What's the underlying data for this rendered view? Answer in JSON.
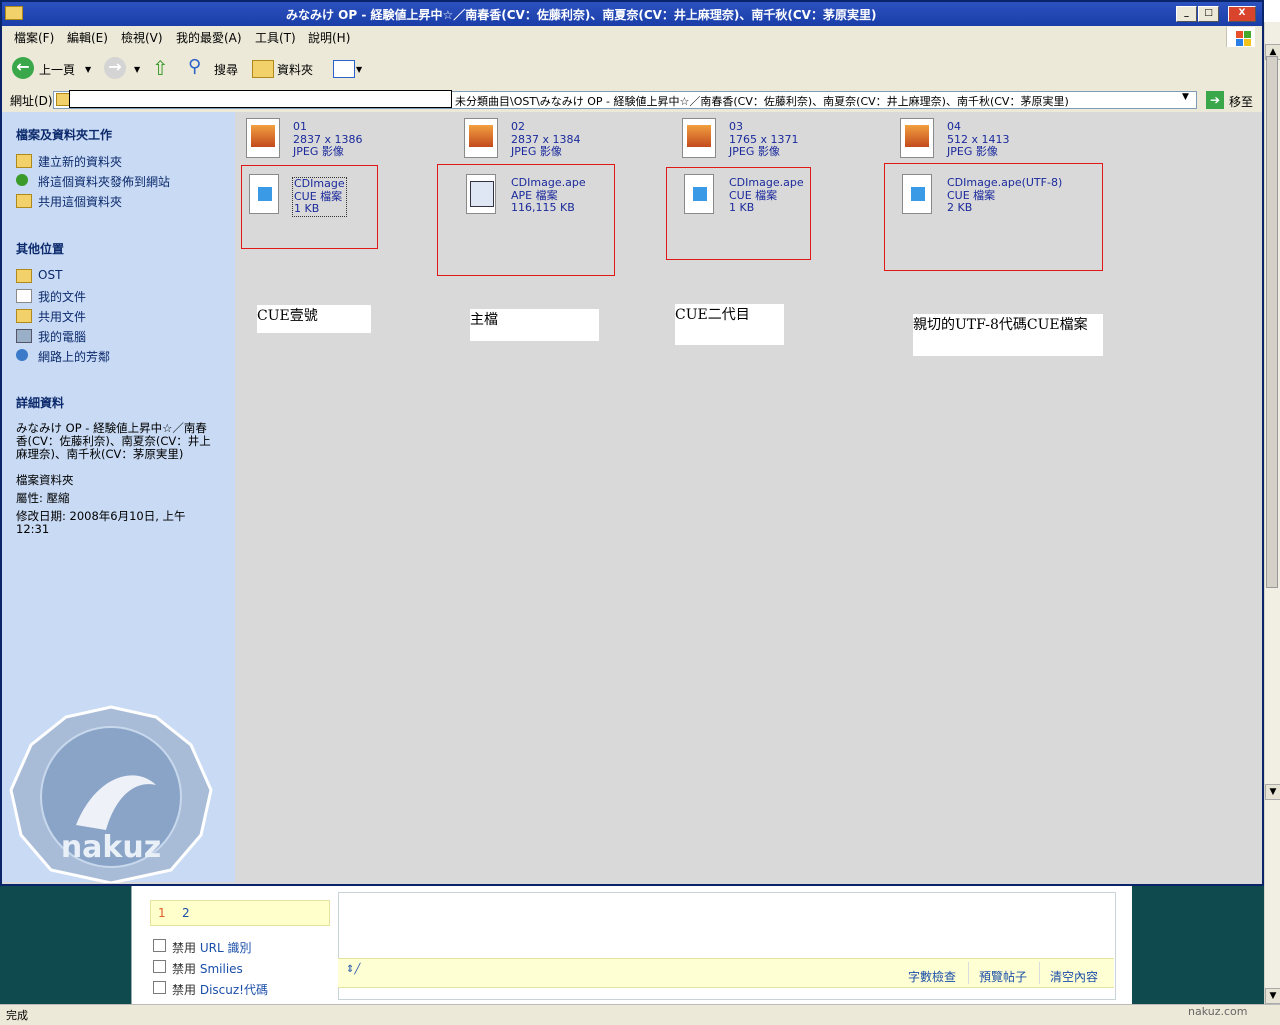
{
  "window": {
    "title": "みなみけ OP - 経験値上昇中☆／南春香(CV：佐藤利奈)、南夏奈(CV：井上麻理奈)、南千秋(CV：茅原実里)",
    "minimize_glyph": "_",
    "maximize_glyph": "□",
    "close_glyph": "X"
  },
  "menu": {
    "items": [
      "檔案(F)",
      "編輯(E)",
      "檢視(V)",
      "我的最愛(A)",
      "工具(T)",
      "說明(H)"
    ]
  },
  "toolbar": {
    "back_label": "上一頁",
    "search_label": "搜尋",
    "folders_label": "資料夾"
  },
  "address": {
    "label": "網址(D)",
    "path": "未分類曲目\\OST\\みなみけ OP - 経験値上昇中☆／南春香(CV：佐藤利奈)、南夏奈(CV：井上麻理奈)、南千秋(CV：茅原実里)",
    "go_label": "移至"
  },
  "taskpane": {
    "file_tasks": {
      "heading": "檔案及資料夾工作",
      "items": [
        "建立新的資料夾",
        "將這個資料夾發佈到網站",
        "共用這個資料夾"
      ]
    },
    "other_places": {
      "heading": "其他位置",
      "items": [
        "OST",
        "我的文件",
        "共用文件",
        "我的電腦",
        "網路上的芳鄰"
      ]
    },
    "details": {
      "heading": "詳細資料",
      "name": "みなみけ OP - 経験値上昇中☆／南春香(CV：佐藤利奈)、南夏奈(CV：井上麻理奈)、南千秋(CV：茅原実里)",
      "type": "檔案資料夾",
      "attributes": "屬性: 壓縮",
      "modified": "修改日期: 2008年6月10日, 上午 12:31"
    },
    "seal_text": "nakuz"
  },
  "files": {
    "images": [
      {
        "name": "01",
        "dims": "2837 x 1386",
        "type": "JPEG 影像"
      },
      {
        "name": "02",
        "dims": "2837 x 1384",
        "type": "JPEG 影像"
      },
      {
        "name": "03",
        "dims": "1765 x 1371",
        "type": "JPEG 影像"
      },
      {
        "name": "04",
        "dims": "512 x 1413",
        "type": "JPEG 影像"
      }
    ],
    "docs": [
      {
        "name": "CDImage",
        "type": "CUE 檔案",
        "size": "1 KB"
      },
      {
        "name": "CDImage.ape",
        "type": "APE 檔案",
        "size": "116,115 KB"
      },
      {
        "name": "CDImage.ape",
        "type": "CUE 檔案",
        "size": "1 KB"
      },
      {
        "name": "CDImage.ape(UTF-8)",
        "type": "CUE 檔案",
        "size": "2 KB"
      }
    ]
  },
  "annotations": [
    "CUE壹號",
    "主檔",
    "CUE二代目",
    "親切的UTF-8代碼CUE檔案"
  ],
  "background_page": {
    "tabs": [
      "1",
      "2"
    ],
    "options": [
      {
        "prefix": "禁用",
        "link": "URL 識別"
      },
      {
        "prefix": "禁用",
        "link": "Smilies"
      },
      {
        "prefix": "禁用",
        "link": "Discuz!代碼"
      }
    ],
    "buttons": [
      "字數檢查",
      "預覽帖子",
      "清空內容"
    ],
    "status": "完成",
    "watermark": "nakuz.com"
  }
}
